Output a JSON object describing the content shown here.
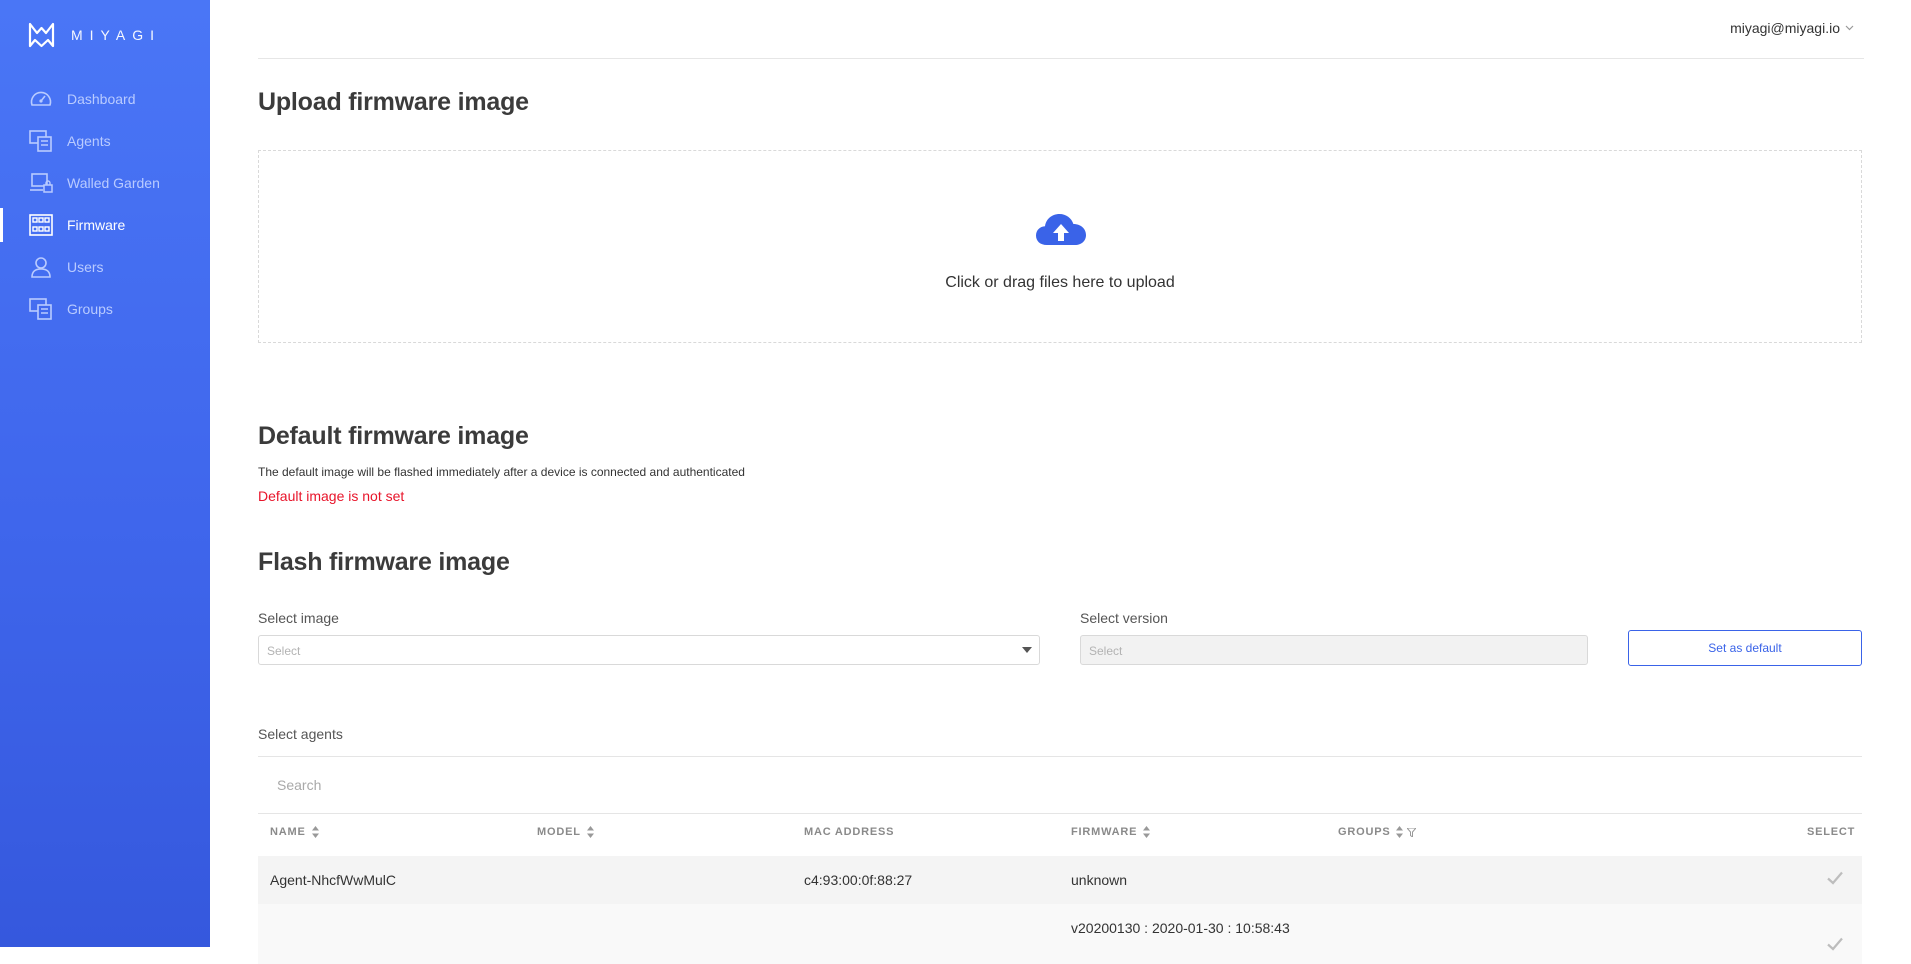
{
  "app": {
    "brand": "MIYAGI",
    "accent": "#3a63e8",
    "sidebar_color": "#4169f0",
    "warning_color": "#e8142a"
  },
  "sidebar": {
    "items": [
      {
        "label": "Dashboard",
        "icon": "dashboard-gauge-icon",
        "active": false
      },
      {
        "label": "Agents",
        "icon": "agents-devices-icon",
        "active": false
      },
      {
        "label": "Walled Garden",
        "icon": "walled-garden-laptop-lock-icon",
        "active": false
      },
      {
        "label": "Firmware",
        "icon": "firmware-grid-icon",
        "active": true
      },
      {
        "label": "Users",
        "icon": "users-person-icon",
        "active": false
      },
      {
        "label": "Groups",
        "icon": "groups-devices-icon",
        "active": false
      }
    ]
  },
  "header": {
    "user_email": "miyagi@miyagi.io",
    "user_icon": "chevron-down-icon"
  },
  "upload": {
    "title": "Upload firmware image",
    "dropzone_text": "Click or drag files here to upload",
    "icon": "cloud-upload-icon"
  },
  "default_image": {
    "title": "Default firmware image",
    "description": "The default image will be flashed immediately after a device is connected and authenticated",
    "status": "Default image is not set"
  },
  "flash": {
    "title": "Flash firmware image",
    "image_label": "Select image",
    "image_placeholder": "Select",
    "version_label": "Select version",
    "version_placeholder": "Select",
    "set_default_label": "Set as default"
  },
  "agents": {
    "title": "Select agents",
    "search_placeholder": "Search",
    "columns": [
      "NAME",
      "MODEL",
      "MAC ADDRESS",
      "FIRMWARE",
      "GROUPS",
      "SELECT"
    ],
    "rows": [
      {
        "name": "Agent-NhcfWwMulC",
        "model": "",
        "mac": "c4:93:00:0f:88:27",
        "firmware": "unknown",
        "groups": "",
        "selected_icon": "checkmark-icon"
      },
      {
        "name": "",
        "model": "",
        "mac": "",
        "firmware": "v20200130 : 2020-01-30 : 10:58:43",
        "groups": "",
        "selected_icon": "checkmark-icon"
      }
    ]
  }
}
